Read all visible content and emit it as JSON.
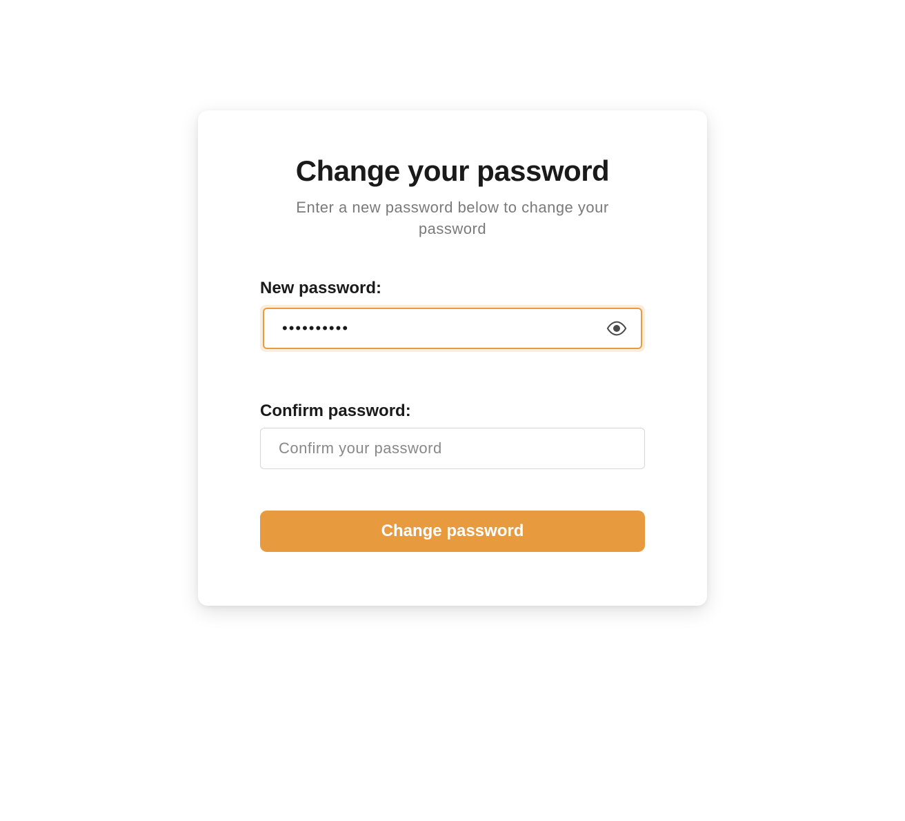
{
  "card": {
    "title": "Change your password",
    "subtitle": "Enter a new password below to change your password"
  },
  "fields": {
    "new_password": {
      "label": "New password:",
      "value": "••••••••••",
      "placeholder": ""
    },
    "confirm_password": {
      "label": "Confirm password:",
      "value": "",
      "placeholder": "Confirm your password"
    }
  },
  "actions": {
    "submit_label": "Change password"
  },
  "colors": {
    "accent": "#e89b3e"
  },
  "icons": {
    "eye": "eye-icon"
  }
}
